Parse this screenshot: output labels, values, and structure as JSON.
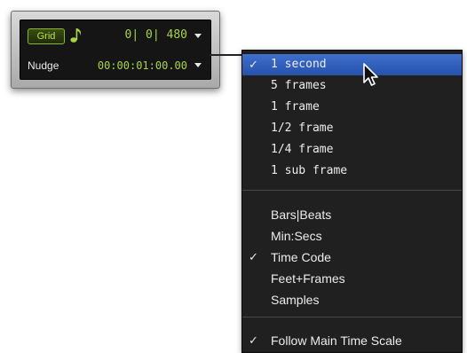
{
  "panel": {
    "grid_label": "Grid",
    "grid_icon": "eighth-note-icon",
    "grid_value": "0| 0| 480",
    "nudge_label": "Nudge",
    "nudge_value": "00:00:01:00.00",
    "accent_color": "#a9d44a"
  },
  "menu": {
    "check_mark": "✓",
    "group1": [
      {
        "label": "1 second",
        "checked": true,
        "highlighted": true
      },
      {
        "label": "5 frames",
        "checked": false
      },
      {
        "label": "1 frame",
        "checked": false
      },
      {
        "label": "1/2 frame",
        "checked": false
      },
      {
        "label": "1/4 frame",
        "checked": false
      },
      {
        "label": "1 sub frame",
        "checked": false
      }
    ],
    "group2": [
      {
        "label": "Bars|Beats",
        "checked": false
      },
      {
        "label": "Min:Secs",
        "checked": false
      },
      {
        "label": "Time Code",
        "checked": true
      },
      {
        "label": "Feet+Frames",
        "checked": false
      },
      {
        "label": "Samples",
        "checked": false
      }
    ],
    "group3": [
      {
        "label": "Follow Main Time Scale",
        "checked": true
      }
    ],
    "highlight_color": "#3465c5"
  }
}
